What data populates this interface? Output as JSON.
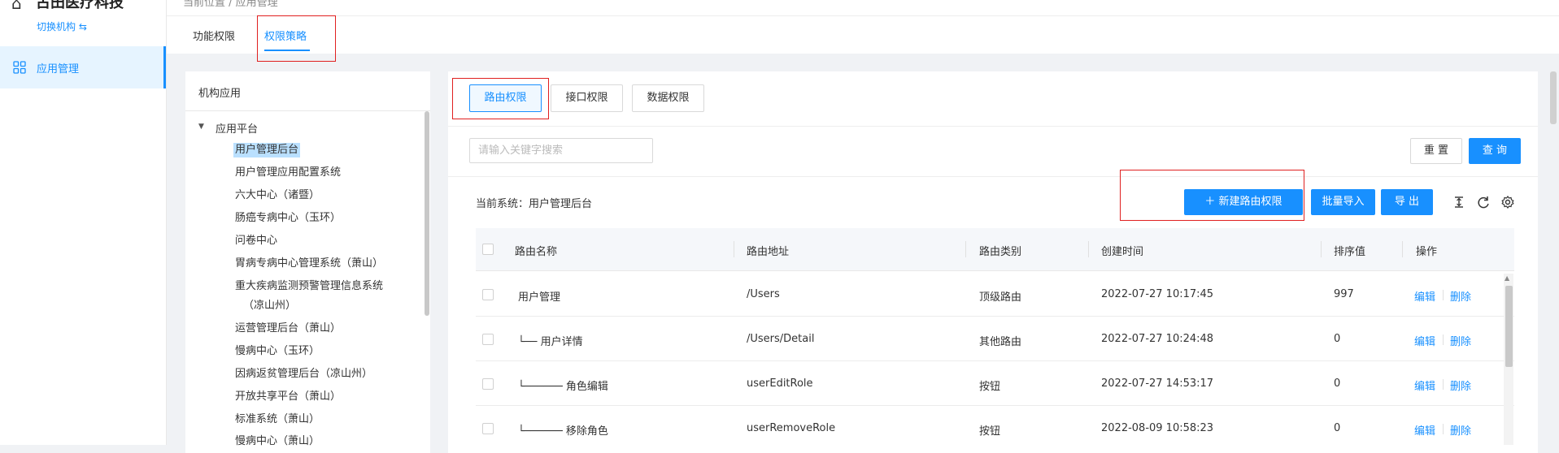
{
  "org": {
    "name": "古田医疗科技",
    "switch_label": "切换机构 ⇆"
  },
  "breadcrumb": "当前位置 / 应用管理",
  "sidebar": {
    "items": [
      {
        "label": "应用管理",
        "icon": "apps-grid-icon",
        "active": true
      }
    ]
  },
  "tabs": [
    {
      "label": "功能权限"
    },
    {
      "label": "权限策略",
      "active": true
    }
  ],
  "tree": {
    "title": "机构应用",
    "root": "应用平台",
    "nodes": [
      "用户管理后台",
      "用户管理应用配置系统",
      "六大中心（诸暨）",
      "肠癌专病中心（玉环）",
      "问卷中心",
      "胃病专病中心管理系统（萧山）",
      "重大疾病监测预警管理信息系统",
      "（凉山州）",
      "运营管理后台（萧山）",
      "慢病中心（玉环）",
      "因病返贫管理后台（凉山州）",
      "开放共享平台（萧山）",
      "标准系统（萧山）",
      "慢病中心（萧山）"
    ],
    "selected_index": 0
  },
  "subtabs": [
    {
      "label": "路由权限",
      "active": true
    },
    {
      "label": "接口权限"
    },
    {
      "label": "数据权限"
    }
  ],
  "search": {
    "placeholder": "请输入关键字搜索",
    "value": ""
  },
  "buttons": {
    "reset": "重 置",
    "query": "查 询",
    "new": "＋ 新建路由权限",
    "import": "批量导入",
    "export": "导 出"
  },
  "current_system_label": "当前系统：用户管理后台",
  "table": {
    "headers": [
      "路由名称",
      "路由地址",
      "路由类别",
      "创建时间",
      "排序值",
      "操作"
    ],
    "rows": [
      {
        "name": "用户管理",
        "path": "/Users",
        "type": "顶级路由",
        "created": "2022-07-27 10:17:45",
        "order": "997"
      },
      {
        "name": "└── 用户详情",
        "path": "/Users/Detail",
        "type": "其他路由",
        "created": "2022-07-27 10:24:48",
        "order": "0"
      },
      {
        "name": "└────── 角色编辑",
        "path": "userEditRole",
        "type": "按钮",
        "created": "2022-07-27 14:53:17",
        "order": "0"
      },
      {
        "name": "└────── 移除角色",
        "path": "userRemoveRole",
        "type": "按钮",
        "created": "2022-08-09 10:58:23",
        "order": "0"
      }
    ],
    "actions": {
      "edit": "编辑",
      "delete": "删除"
    }
  },
  "colors": {
    "accent": "#1890ff",
    "highlight_box": "#e02020",
    "selected_bg": "#bae0ff"
  }
}
